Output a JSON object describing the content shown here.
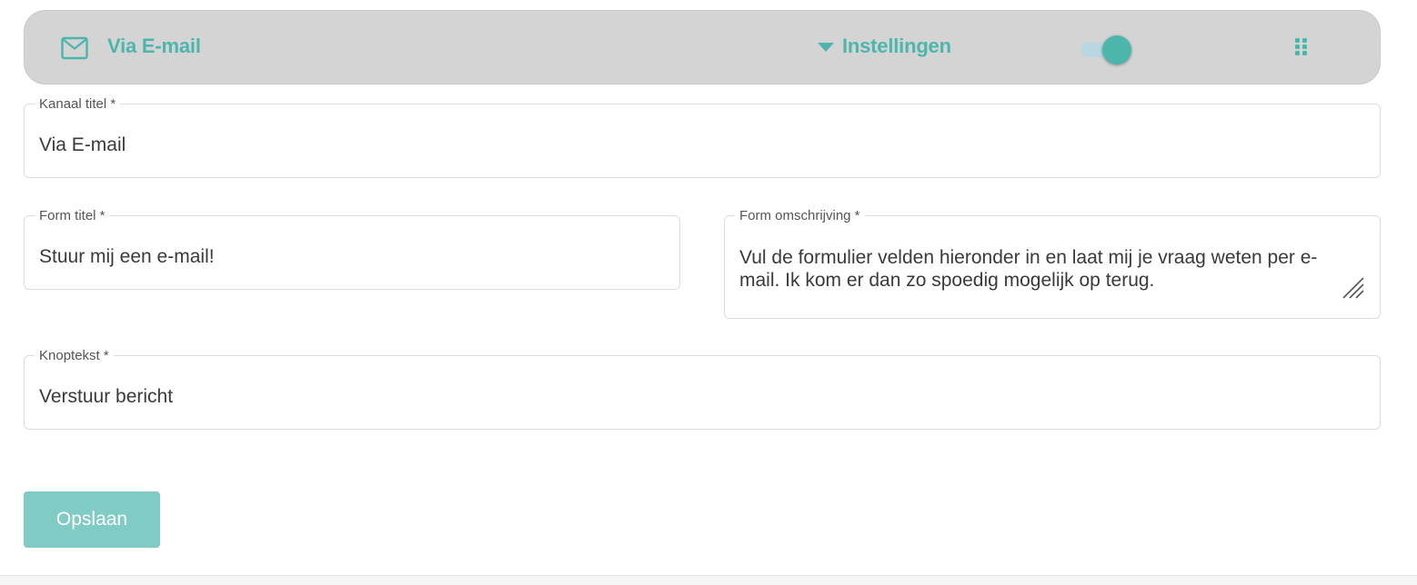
{
  "header": {
    "channel_title": "Via E-mail",
    "settings_label": "Instellingen",
    "toggle_checked": true,
    "icons": {
      "channel": "mail-icon",
      "settings": "caret-down-icon",
      "drag": "drag-handle-icon"
    }
  },
  "form": {
    "channel_title": {
      "label": "Kanaal titel *",
      "value": "Via E-mail"
    },
    "form_title": {
      "label": "Form titel *",
      "value": "Stuur mij een e-mail!"
    },
    "form_description": {
      "label": "Form omschrijving *",
      "value": "Vul de formulier velden hieronder in en laat mij je vraag weten per e-mail. Ik kom er dan zo spoedig mogelijk op terug."
    },
    "button_text": {
      "label": "Knoptekst *",
      "value": "Verstuur bericht"
    }
  },
  "actions": {
    "save_label": "Opslaan"
  },
  "colors": {
    "accent": "#4db6ac",
    "button": "#80cbc4",
    "header_bg": "#d4d4d4",
    "switch_track": "#b9d6e3"
  }
}
